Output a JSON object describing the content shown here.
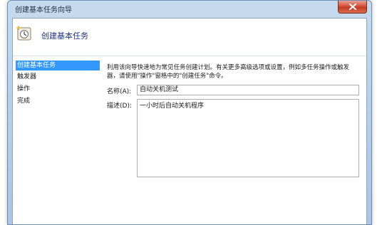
{
  "window": {
    "title": "创建基本任务向导"
  },
  "header": {
    "title": "创建基本任务"
  },
  "sidebar": {
    "items": [
      {
        "label": "创建基本任务",
        "active": true
      },
      {
        "label": "触发器",
        "active": false
      },
      {
        "label": "操作",
        "active": false
      },
      {
        "label": "完成",
        "active": false
      }
    ]
  },
  "main": {
    "description_line1": "利用该向导快速地为常见任务创建计划。有关更多高级选项或设置，例如多任务操作或触发",
    "description_line2": "器，请使用\"操作\"窗格中的\"创建任务\"命令。",
    "name_label": "名称(A):",
    "name_value": "自动关机测试",
    "desc_label": "描述(D):",
    "desc_value": "一小时后自动关机程序"
  },
  "colors": {
    "selection": "#3399ff",
    "title_blue": "#1e3287",
    "close_red": "#c23b22"
  },
  "icons": {
    "header": "task-scheduler-clock-icon",
    "close": "close-icon"
  }
}
